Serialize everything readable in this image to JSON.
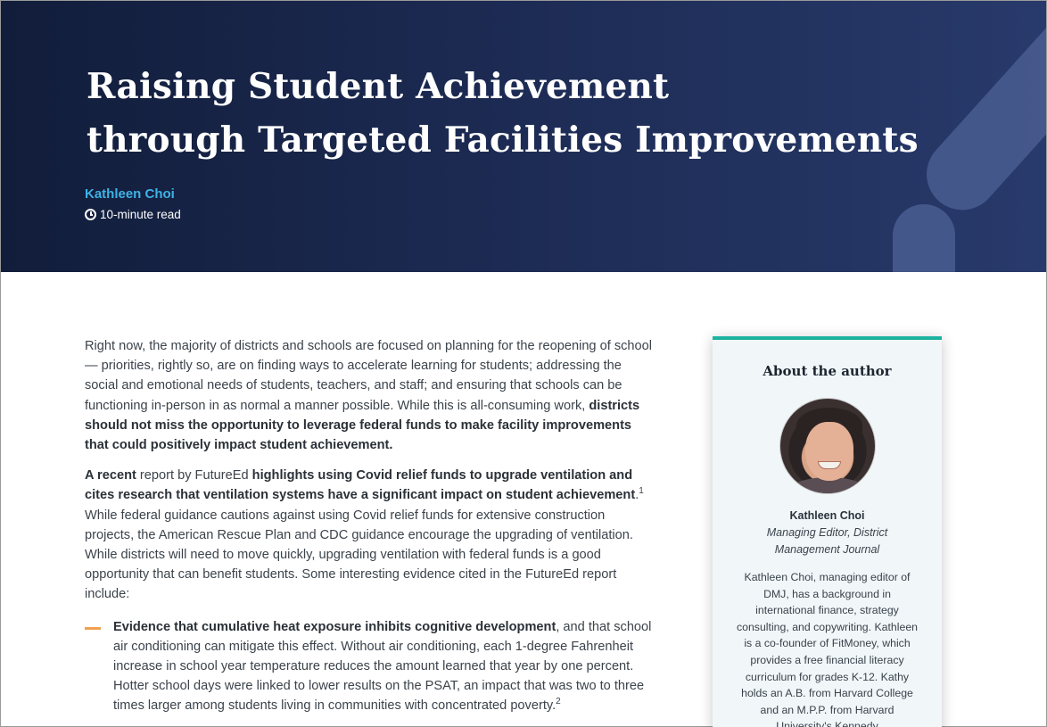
{
  "header": {
    "title_line1": "Raising Student Achievement",
    "title_line2": "through Targeted Facilities Improvements",
    "author": "Kathleen Choi",
    "read_time": "10-minute read"
  },
  "article": {
    "p1_text": "Right now, the majority of districts and schools are focused on planning for the reopening of school — priorities, rightly so, are on finding ways to accelerate learning for students; addressing the social and emotional needs of students, teachers, and staff; and ensuring that schools can be functioning in-person in as normal a manner possible. While this is all-consuming work, ",
    "p1_bold": "districts should not miss the opportunity to leverage federal funds to make facility improvements that could positively impact student achievement.",
    "p2_bold1": "A recent",
    "p2_text1": " report by FutureEd ",
    "p2_bold2": "highlights using Covid relief funds to upgrade ventilation and cites research that ventilation systems have a significant impact on student achievement",
    "p2_text2": ".",
    "p2_sup": "1",
    "p2_text3": " While federal guidance cautions against using Covid relief funds for extensive construction projects, the American Rescue Plan and CDC guidance encourage the upgrading of ventilation. While districts will need to move quickly, upgrading ventilation with federal funds is a good opportunity that can benefit students. Some interesting evidence cited in the FutureEd report include:",
    "bullet1_bold": "Evidence that cumulative heat exposure inhibits cognitive development",
    "bullet1_text": ", and that school air conditioning can mitigate this effect. Without air conditioning, each 1-degree Fahrenheit increase in school year temperature reduces the amount learned that year by one percent. Hotter school days were linked to lower results on the PSAT, an impact that was two to three times larger among students living in communities with concentrated poverty.",
    "bullet1_sup": "2"
  },
  "sidebar": {
    "heading": "About the author",
    "name": "Kathleen Choi",
    "role": "Managing Editor, District Management Journal",
    "bio": "Kathleen Choi, managing editor of DMJ, has a background in international finance, strategy consulting, and copywriting. Kathleen is a co-founder of FitMoney, which provides a free financial literacy curriculum for grades K-12. Kathy holds an A.B. from Harvard College and an M.P.P. from Harvard University's Kennedy"
  },
  "colors": {
    "accent_blue": "#3fb2e6",
    "accent_teal": "#1bb3a0",
    "bullet_orange": "#f0a050",
    "hero_dark": "#111d3a"
  }
}
